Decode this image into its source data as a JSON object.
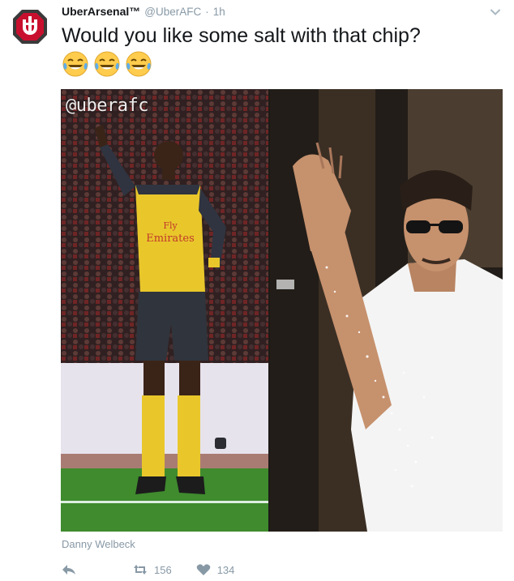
{
  "tweet": {
    "display_name": "UberArsenal™",
    "handle": "@UberAFC",
    "separator": "·",
    "time": "1h",
    "text": "Would you like some salt with that chip?",
    "emoji": [
      "😂",
      "😂",
      "😂"
    ],
    "media": {
      "watermark": "@uberafc",
      "left_panel_jersey_text": "Fly Emirates"
    },
    "caption": "Danny Welbeck",
    "actions": {
      "retweets": "156",
      "likes": "134"
    }
  },
  "colors": {
    "text": "#14171a",
    "muted": "#8899a6",
    "avatar_red": "#c8102e",
    "avatar_border": "#2b2b2b",
    "jersey_yellow": "#e9c72b"
  }
}
